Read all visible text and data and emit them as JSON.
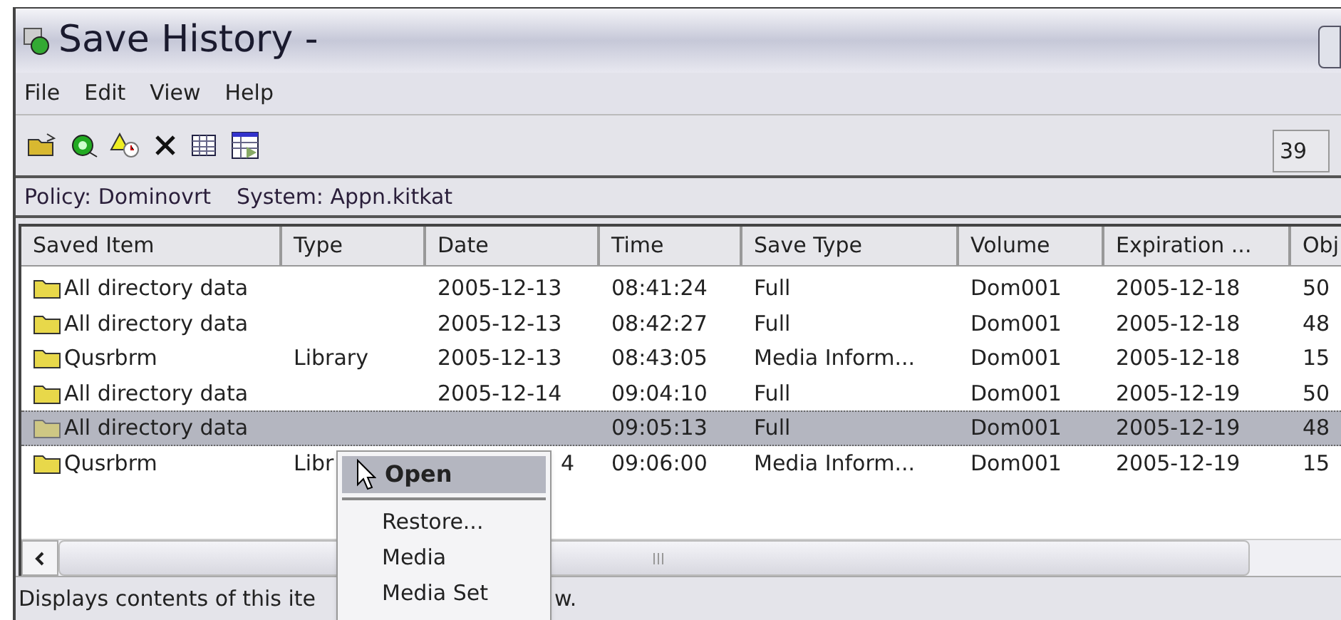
{
  "window": {
    "title": "Save History -"
  },
  "menu": [
    "File",
    "Edit",
    "View",
    "Help"
  ],
  "toolbar": {
    "count": "39"
  },
  "info": [
    "Policy: Dominovrt",
    "System: Appn.kitkat"
  ],
  "table": {
    "columns": [
      "Saved Item",
      "Type",
      "Date",
      "Time",
      "Save Type",
      "Volume",
      "Expiration ...",
      "Obj"
    ],
    "rows": [
      {
        "selected": false,
        "cells": [
          "All directory data",
          "",
          "2005-12-13",
          "08:41:24",
          "Full",
          "Dom001",
          "2005-12-18",
          "50"
        ]
      },
      {
        "selected": false,
        "cells": [
          "All directory data",
          "",
          "2005-12-13",
          "08:42:27",
          "Full",
          "Dom001",
          "2005-12-18",
          "48"
        ]
      },
      {
        "selected": false,
        "cells": [
          "Qusrbrm",
          "Library",
          "2005-12-13",
          "08:43:05",
          "Media Inform...",
          "Dom001",
          "2005-12-18",
          "15"
        ]
      },
      {
        "selected": false,
        "cells": [
          "All directory data",
          "",
          "2005-12-14",
          "09:04:10",
          "Full",
          "Dom001",
          "2005-12-19",
          "50"
        ]
      },
      {
        "selected": true,
        "cells": [
          "All directory data",
          "",
          "",
          "09:05:13",
          "Full",
          "Dom001",
          "2005-12-19",
          "48"
        ]
      },
      {
        "selected": false,
        "cells": [
          "Qusrbrm",
          "Libr",
          "4",
          "09:06:00",
          "Media Inform...",
          "Dom001",
          "2005-12-19",
          "15"
        ]
      }
    ]
  },
  "context_menu": [
    {
      "label": "Open",
      "selected": true
    },
    {
      "label": "Restore...",
      "selected": false
    },
    {
      "label": "Media",
      "selected": false
    },
    {
      "label": "Media Set",
      "selected": false
    }
  ],
  "status_bar": [
    "Displays contents of this ite",
    "w."
  ]
}
